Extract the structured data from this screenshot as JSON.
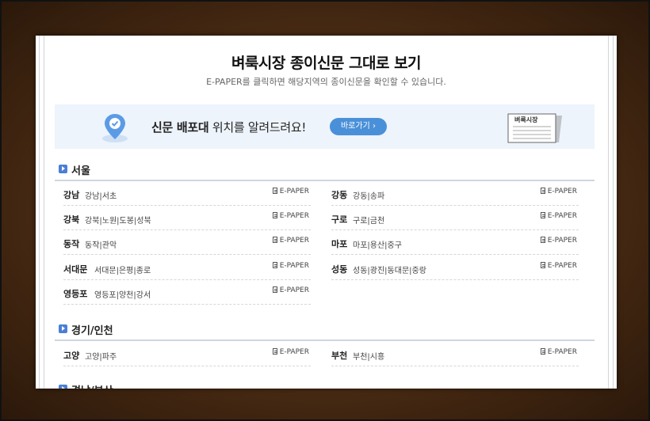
{
  "header": {
    "title": "벼룩시장 종이신문 그대로 보기",
    "subtitle": "E-PAPER를 클릭하면 해당지역의 종이신문을 확인할 수 있습니다."
  },
  "banner": {
    "text_bold": "신문 배포대",
    "text_rest": " 위치를 알려드려요!",
    "button_label": "바로가기 ›",
    "paper_label": "벼룩시장"
  },
  "sections": [
    {
      "name": "서울",
      "rows": [
        {
          "region": "강남",
          "areas": "강남|서초",
          "link": "E-PAPER"
        },
        {
          "region": "강동",
          "areas": "강동|송파",
          "link": "E-PAPER"
        },
        {
          "region": "강북",
          "areas": "강북|노원|도봉|성북",
          "link": "E-PAPER"
        },
        {
          "region": "구로",
          "areas": "구로|금천",
          "link": "E-PAPER"
        },
        {
          "region": "동작",
          "areas": "동작|관악",
          "link": "E-PAPER"
        },
        {
          "region": "마포",
          "areas": "마포|용산|중구",
          "link": "E-PAPER"
        },
        {
          "region": "서대문",
          "areas": "서대문|은평|종로",
          "link": "E-PAPER"
        },
        {
          "region": "성동",
          "areas": "성동|광진|동대문|중랑",
          "link": "E-PAPER"
        },
        {
          "region": "영등포",
          "areas": "영등포|양천|강서",
          "link": "E-PAPER"
        }
      ]
    },
    {
      "name": "경기/인천",
      "rows": [
        {
          "region": "고양",
          "areas": "고양|파주",
          "link": "E-PAPER"
        },
        {
          "region": "부천",
          "areas": "부천|시흥",
          "link": "E-PAPER"
        }
      ]
    },
    {
      "name": "경남/부산",
      "rows": []
    }
  ],
  "colors": {
    "accent": "#4a90d9",
    "banner_bg": "#edf4fc",
    "frame": "#4a2c14"
  }
}
